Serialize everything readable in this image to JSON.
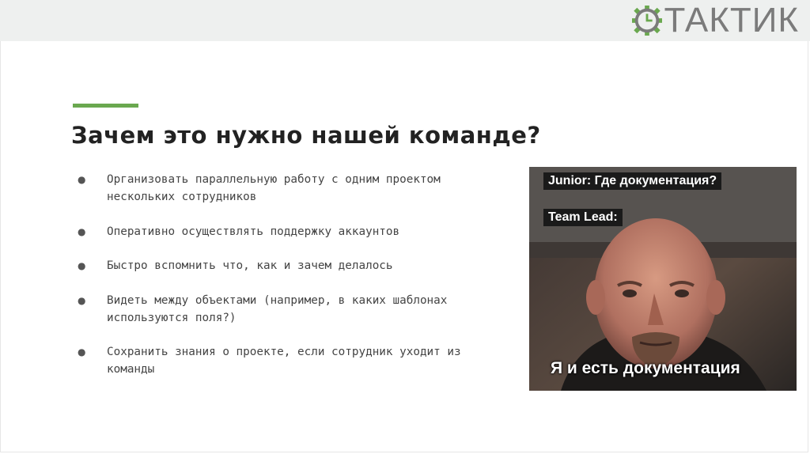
{
  "header": {
    "logo_text": "ТАКТИК",
    "logo_icon": "gear-clock-icon"
  },
  "slide": {
    "title": "Зачем это нужно нашей команде?",
    "bullets": [
      "Организовать параллельную работу с одним проектом нескольких сотрудников",
      "Оперативно осуществлять поддержку аккаунтов",
      "Быстро вспомнить что, как и зачем делалось",
      "Видеть между объектами (например, в каких шаблонах используются поля?)",
      "Сохранить знания о проекте, если сотрудник уходит из команды"
    ]
  },
  "meme": {
    "line_1": "Junior: Где документация?",
    "line_2": "Team Lead:",
    "bottom_text": "Я и есть документация"
  },
  "colors": {
    "accent": "#6aa84f",
    "header_band": "#eef0ef",
    "title": "#222222",
    "body_text": "#444444"
  }
}
